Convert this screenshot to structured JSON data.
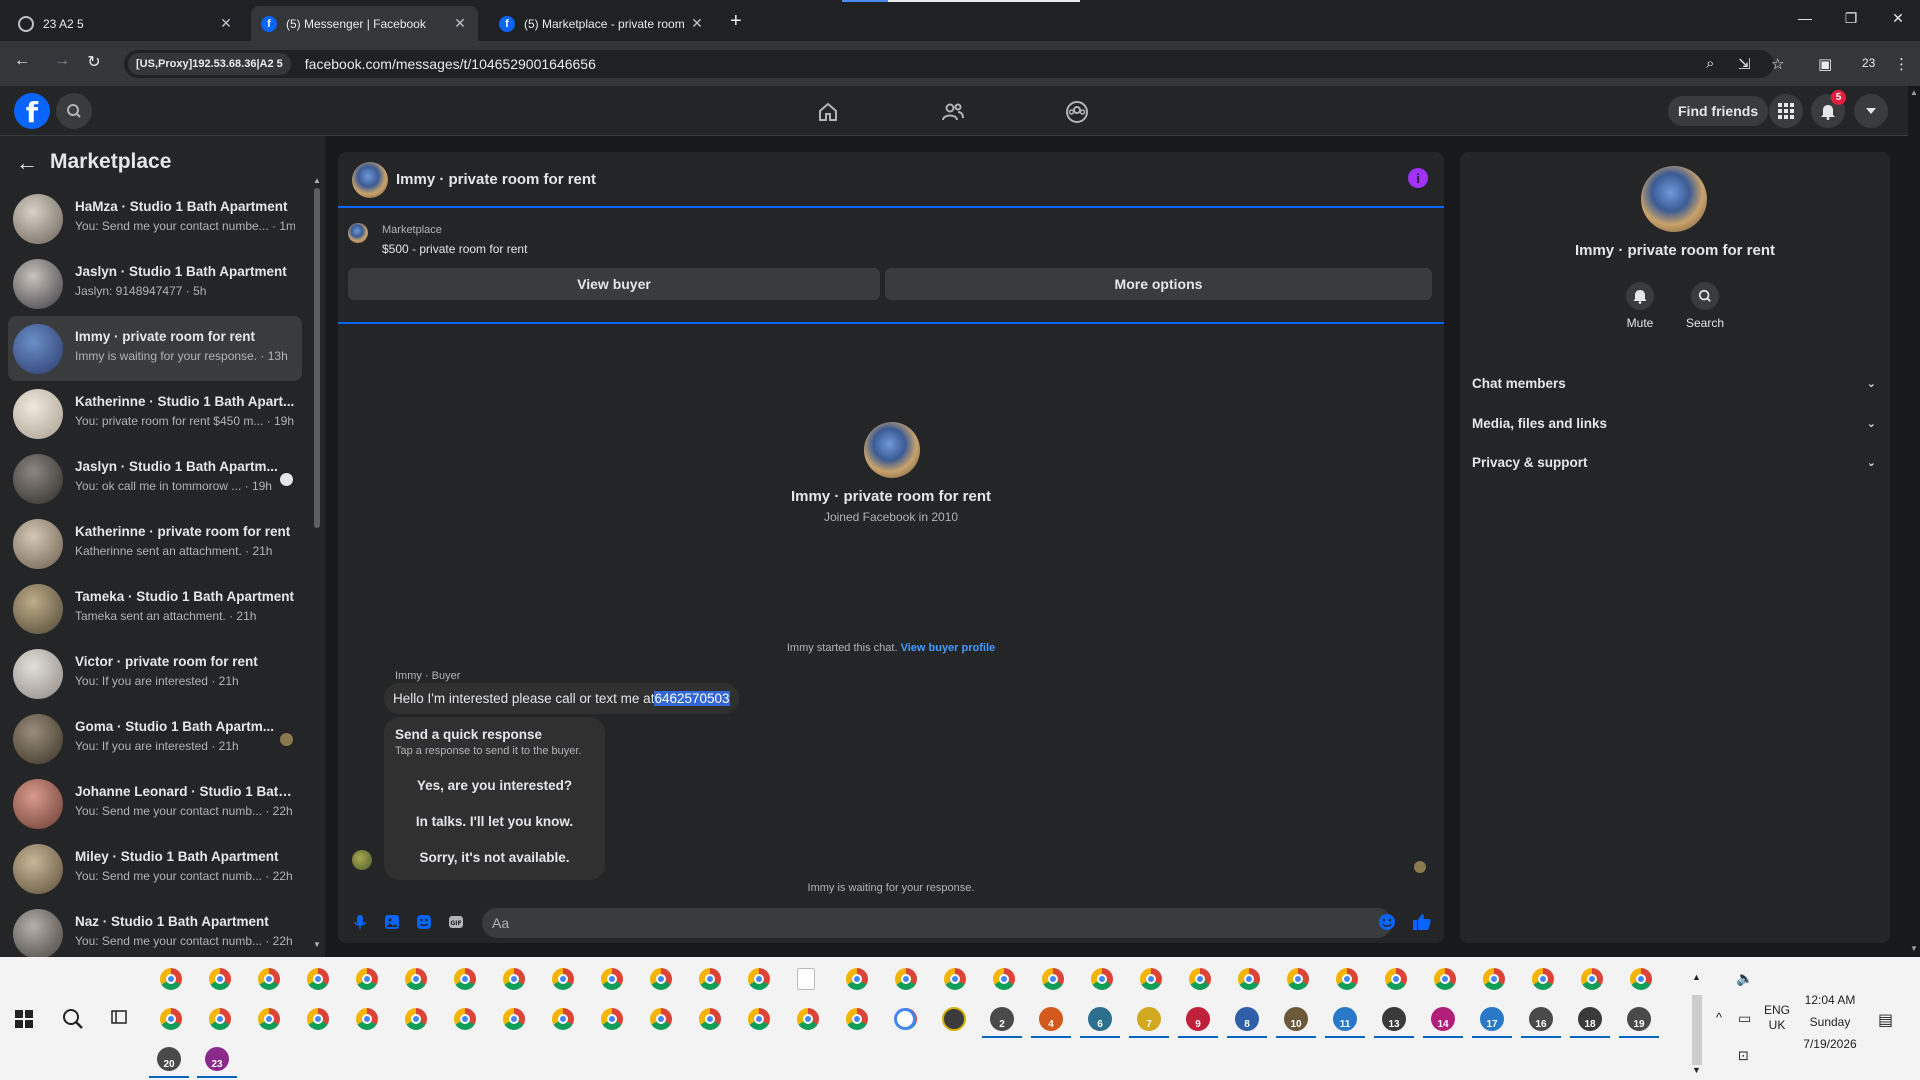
{
  "browser": {
    "tabs": [
      {
        "label": "23 A2 5",
        "icon": "globe-icon",
        "active": false
      },
      {
        "label": "(5) Messenger | Facebook",
        "icon": "facebook-icon",
        "active": true
      },
      {
        "label": "(5) Marketplace - private room",
        "icon": "facebook-icon",
        "active": false
      }
    ],
    "proxy_chip": "[US,Proxy]192.53.68.36|A2 5",
    "url": "facebook.com/messages/t/1046529001646656",
    "profile_count": "23"
  },
  "fb_nav": {
    "find_friends": "Find friends",
    "notification_count": "5"
  },
  "left_pane": {
    "title": "Marketplace",
    "conversations": [
      {
        "name": "HaMza · Studio 1 Bath Apartment",
        "preview": "You: Send me your contact numbe... · 1m",
        "selected": false,
        "marker": ""
      },
      {
        "name": "Jaslyn · Studio 1 Bath Apartment",
        "preview": "Jaslyn: 9148947477 · 5h",
        "selected": false,
        "marker": ""
      },
      {
        "name": "Immy · private room for rent",
        "preview": "Immy is waiting for your response. · 13h",
        "selected": true,
        "marker": ""
      },
      {
        "name": "Katherinne · Studio 1 Bath Apart...",
        "preview": "You: private room for rent $450 m... · 19h",
        "selected": false,
        "marker": ""
      },
      {
        "name": "Jaslyn · Studio 1 Bath Apartm...",
        "preview": "You: ok call me in tommorow ... · 19h",
        "selected": false,
        "marker": "unread"
      },
      {
        "name": "Katherinne · private room for rent",
        "preview": "Katherinne sent an attachment. · 21h",
        "selected": false,
        "marker": ""
      },
      {
        "name": "Tameka · Studio 1 Bath Apartment",
        "preview": "Tameka sent an attachment. · 21h",
        "selected": false,
        "marker": ""
      },
      {
        "name": "Victor · private room for rent",
        "preview": "You: If you are interested · 21h",
        "selected": false,
        "marker": ""
      },
      {
        "name": "Goma · Studio 1 Bath Apartm...",
        "preview": "You: If you are interested · 21h",
        "selected": false,
        "marker": "seen"
      },
      {
        "name": "Johanne Leonard · Studio 1 Bath...",
        "preview": "You: Send me your contact numb... · 22h",
        "selected": false,
        "marker": ""
      },
      {
        "name": "Miley · Studio 1 Bath Apartment",
        "preview": "You: Send me your contact numb... · 22h",
        "selected": false,
        "marker": ""
      },
      {
        "name": "Naz · Studio 1 Bath Apartment",
        "preview": "You: Send me your contact numb... · 22h",
        "selected": false,
        "marker": ""
      }
    ]
  },
  "chat": {
    "title": "Immy · private room for rent",
    "marketplace_label": "Marketplace",
    "listing": "$500 - private room for rent",
    "view_buyer": "View buyer",
    "more_options": "More options",
    "intro_name": "Immy · private room for rent",
    "intro_joined": "Joined Facebook in 2010",
    "started_text": "Immy started this chat.",
    "started_link": "View buyer profile",
    "sender": "Immy · Buyer",
    "message_text": "Hello I'm interested please call or text me at ",
    "message_highlight": "6462570503",
    "quick_title": "Send a quick response",
    "quick_sub": "Tap a response to send it to the buyer.",
    "quick_options": [
      "Yes, are you interested?",
      "In talks. I'll let you know.",
      "Sorry, it's not available."
    ],
    "waiting": "Immy is waiting for your response.",
    "input_placeholder": "Aa"
  },
  "right_pane": {
    "name": "Immy · private room for rent",
    "actions": [
      "Mute",
      "Search"
    ],
    "sections": [
      "Chat members",
      "Media, files and links",
      "Privacy & support"
    ]
  },
  "taskbar": {
    "numbered_icons": [
      "2",
      "4",
      "6",
      "7",
      "9",
      "8",
      "10",
      "11",
      "13",
      "14",
      "17",
      "16",
      "18",
      "19",
      "20",
      "23"
    ],
    "lang": "ENG",
    "region": "UK",
    "time": "12:04 AM",
    "day": "Sunday",
    "date": "7/19/2026"
  },
  "colors": {
    "fb_blue": "#0866ff",
    "info_purple": "#a033ff",
    "badge_red": "#e41e3f",
    "highlight": "#3367d6"
  }
}
